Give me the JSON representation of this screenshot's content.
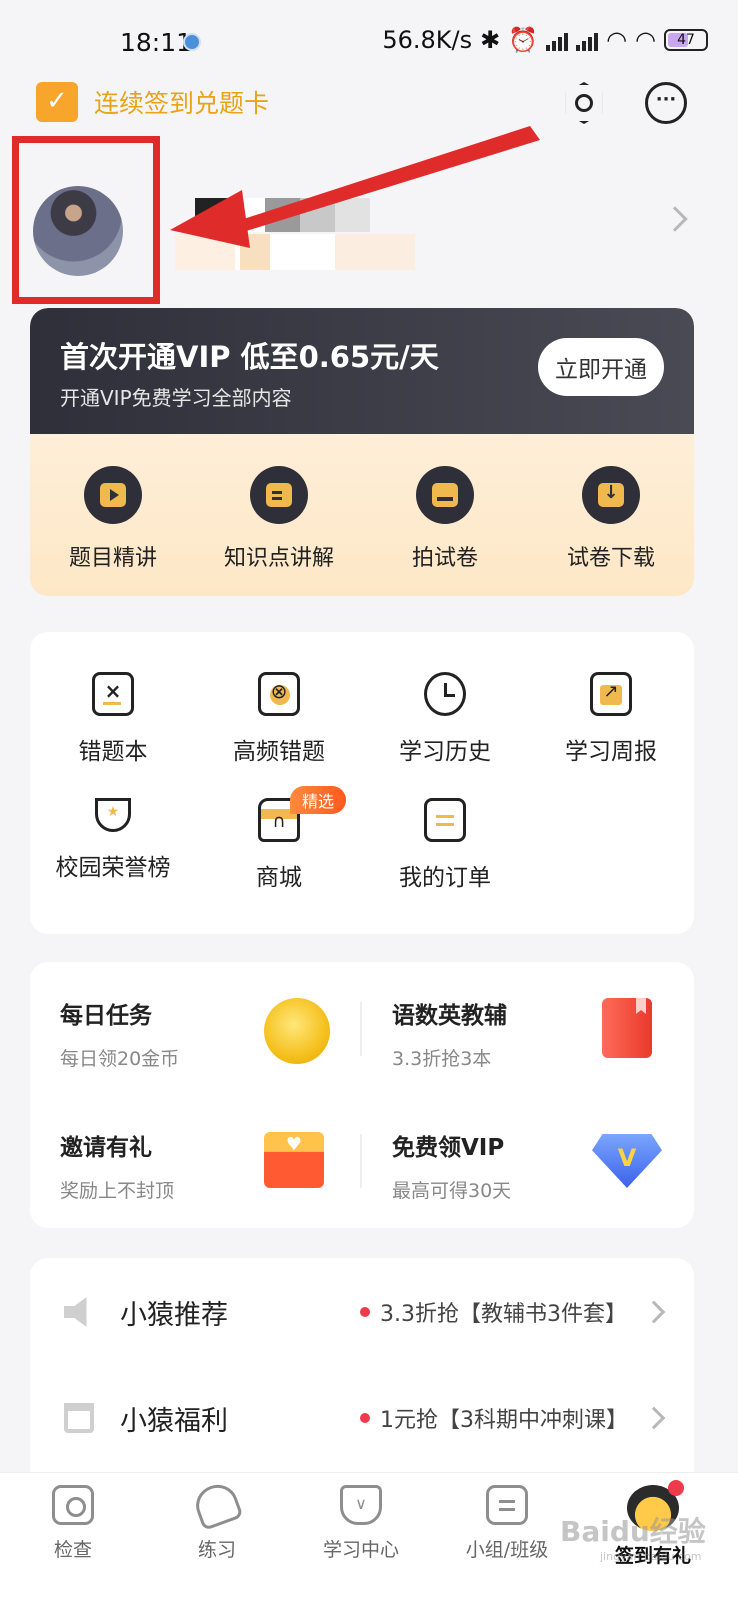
{
  "status_bar": {
    "time": "18:11",
    "net_speed": "56.8K/s",
    "battery": "47"
  },
  "header": {
    "checkin_label": "连续签到兑题卡",
    "icons": [
      "calendar-check-icon",
      "settings-icon",
      "message-icon"
    ]
  },
  "vip": {
    "title": "首次开通VIP 低至0.65元/天",
    "subtitle": "开通VIP免费学习全部内容",
    "button": "立即开通",
    "items": [
      {
        "label": "题目精讲",
        "icon": "play-icon"
      },
      {
        "label": "知识点讲解",
        "icon": "book-icon"
      },
      {
        "label": "拍试卷",
        "icon": "printer-icon"
      },
      {
        "label": "试卷下载",
        "icon": "download-icon"
      }
    ]
  },
  "tools": {
    "items": [
      {
        "label": "错题本",
        "icon": "wrong-book-icon"
      },
      {
        "label": "高频错题",
        "icon": "frequent-error-icon"
      },
      {
        "label": "学习历史",
        "icon": "clock-icon"
      },
      {
        "label": "学习周报",
        "icon": "report-icon"
      },
      {
        "label": "校园荣誉榜",
        "icon": "trophy-icon"
      },
      {
        "label": "商城",
        "icon": "shop-icon",
        "badge": "精选"
      },
      {
        "label": "我的订单",
        "icon": "order-icon"
      }
    ]
  },
  "tasks": [
    {
      "title": "每日任务",
      "sub": "每日领20金币",
      "icon": "coin-icon"
    },
    {
      "title": "语数英教辅",
      "sub": "3.3折抢3本",
      "icon": "red-book-icon"
    },
    {
      "title": "邀请有礼",
      "sub": "奖励上不封顶",
      "icon": "envelope-icon"
    },
    {
      "title": "免费领VIP",
      "sub": "最高可得30天",
      "icon": "diamond-vip-icon"
    }
  ],
  "promos": [
    {
      "title": "小猿推荐",
      "desc": "3.3折抢【教辅书3件套】",
      "icon": "speaker-icon"
    },
    {
      "title": "小猿福利",
      "desc": "1元抢【3科期中冲刺课】",
      "icon": "gift-icon"
    }
  ],
  "bottom_nav": [
    {
      "label": "检查",
      "icon": "camera-icon"
    },
    {
      "label": "练习",
      "icon": "pencil-icon"
    },
    {
      "label": "学习中心",
      "icon": "cup-icon"
    },
    {
      "label": "小组/班级",
      "icon": "list-icon"
    },
    {
      "label": "签到有礼",
      "icon": "mascot-icon",
      "active": true
    }
  ],
  "watermark": {
    "text": "Baidu经验",
    "sub": "jingyan.baidu.com"
  }
}
